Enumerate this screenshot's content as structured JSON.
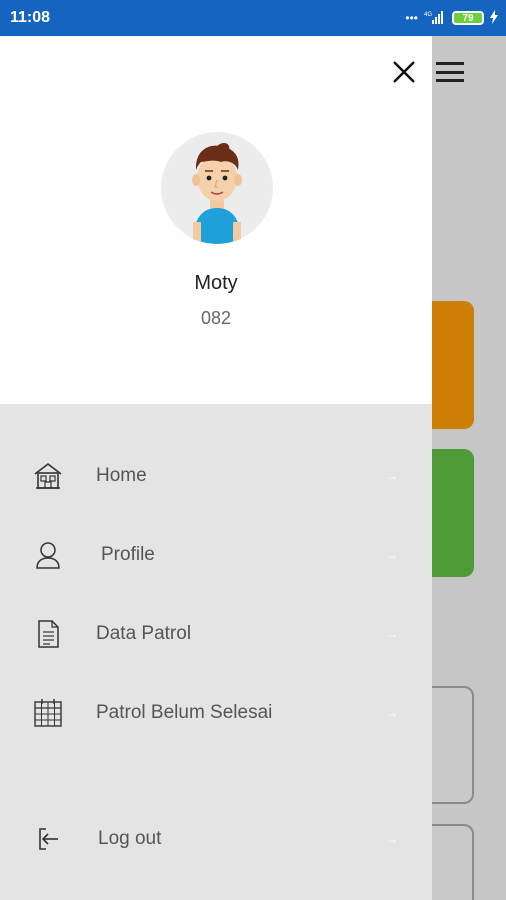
{
  "status_bar": {
    "time": "11:08",
    "dots": "•••",
    "network": "4G",
    "battery": "79"
  },
  "drawer": {
    "user_name": "Moty",
    "user_id": "082",
    "menu": [
      {
        "label": "Home",
        "icon": "home-icon",
        "arrow": "→"
      },
      {
        "label": "Profile",
        "icon": "user-icon",
        "arrow": "→"
      },
      {
        "label": "Data Patrol",
        "icon": "document-icon",
        "arrow": "→"
      },
      {
        "label": "Patrol Belum Selesai",
        "icon": "calendar-icon",
        "arrow": "→"
      },
      {
        "label": "Log out",
        "icon": "logout-icon",
        "arrow": "→"
      }
    ]
  },
  "colors": {
    "status_bar": "#1565c0",
    "orange_card": "#cd7f05",
    "green_card": "#4e9a36",
    "avatar_shirt": "#1da1d8"
  }
}
